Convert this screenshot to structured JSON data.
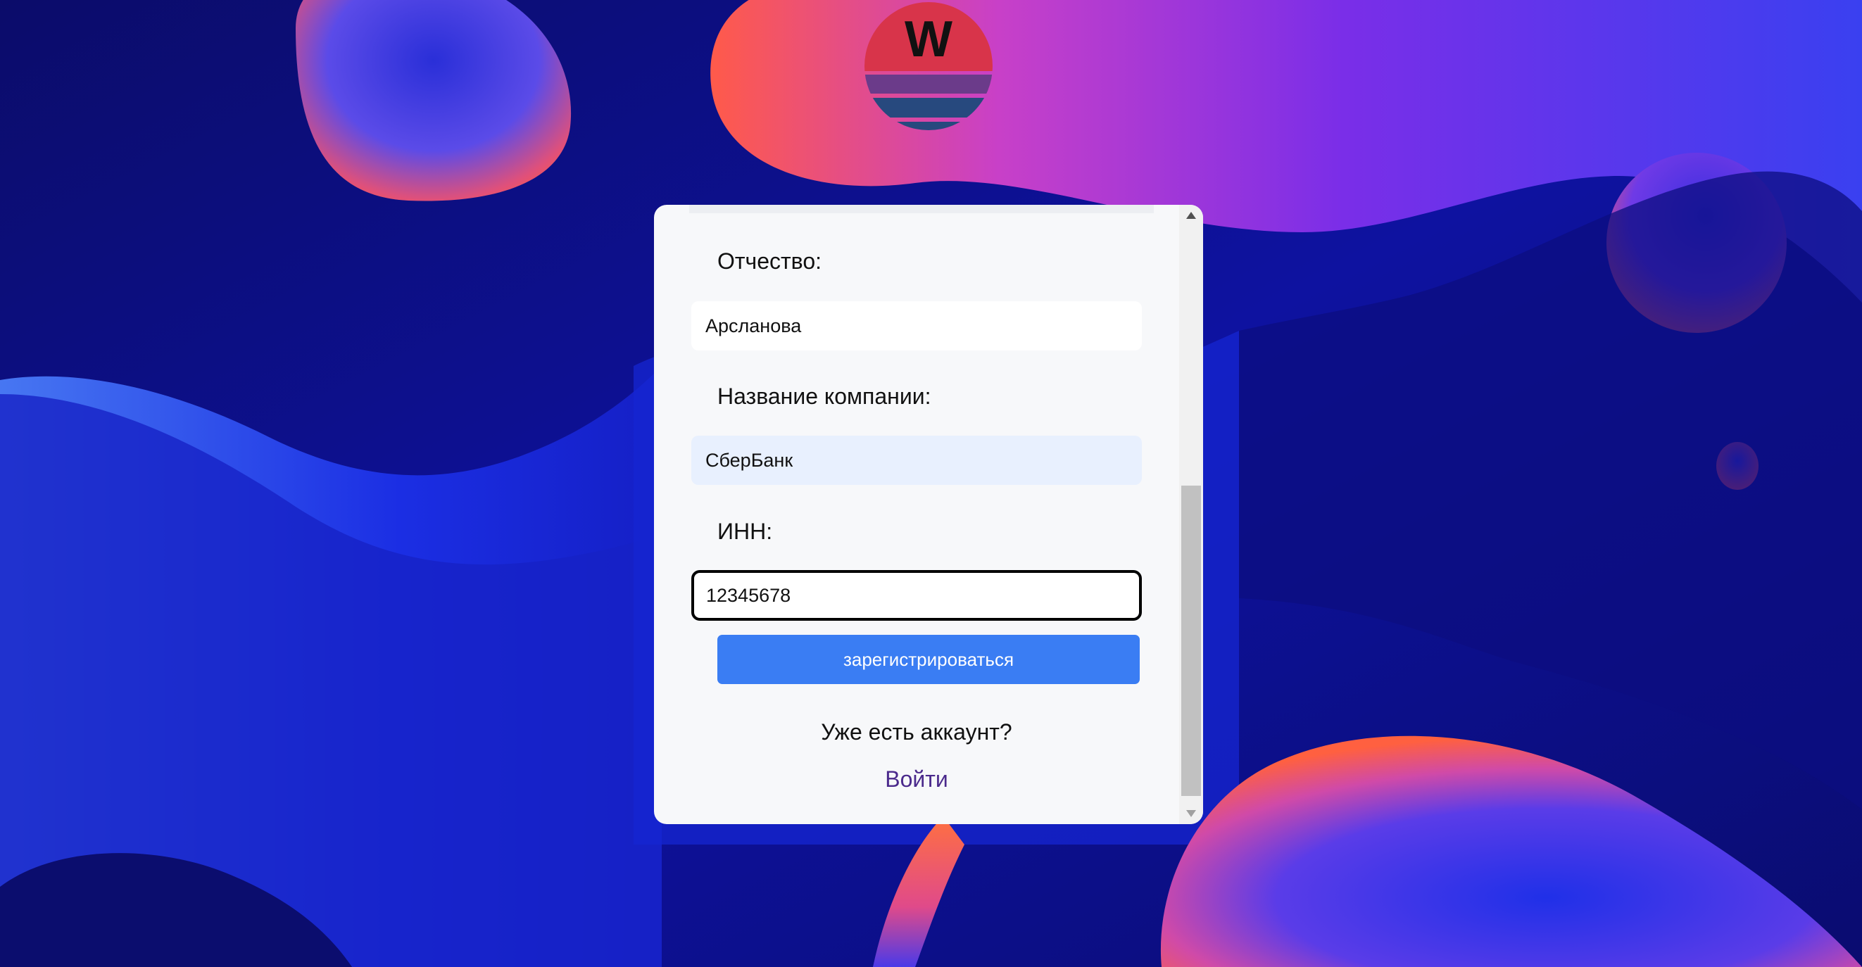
{
  "logo": {
    "letter": "W"
  },
  "form": {
    "fields": [
      {
        "label": "Отчество:",
        "value": "Арсланова",
        "state": "normal"
      },
      {
        "label": "Название компании:",
        "value": "СберБанк",
        "state": "autofill"
      },
      {
        "label": "ИНН:",
        "value": "12345678",
        "state": "focused"
      }
    ],
    "submit_label": "зарегистрироваться",
    "has_account_text": "Уже есть аккаунт?",
    "login_link": "Войти"
  },
  "scrollbar": {
    "position_fraction": 0.45
  },
  "colors": {
    "background": "#0d0f86",
    "card": "#f7f8fa",
    "button": "#3a7df3",
    "link": "#4b2a8c",
    "logo_red": "#d8344a",
    "logo_stripe_purple": "#6b3b8a",
    "logo_stripe_blue": "#27497e"
  }
}
